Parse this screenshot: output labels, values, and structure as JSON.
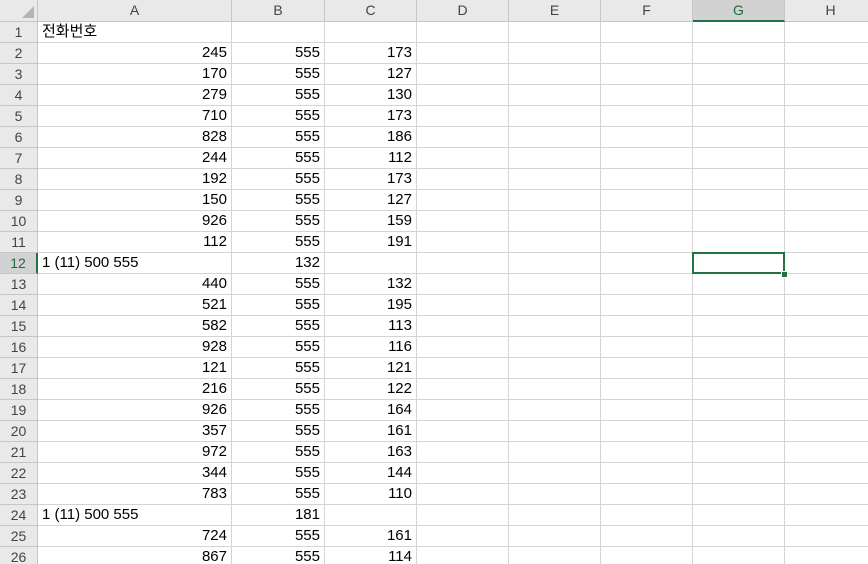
{
  "columns": [
    "A",
    "B",
    "C",
    "D",
    "E",
    "F",
    "G",
    "H"
  ],
  "active_column": "G",
  "active_row": 12,
  "rows": [
    {
      "n": "1",
      "a": "전화번호",
      "a_kind": "text",
      "b": "",
      "c": ""
    },
    {
      "n": "2",
      "a": "245",
      "a_kind": "num",
      "b": "555",
      "c": "173"
    },
    {
      "n": "3",
      "a": "170",
      "a_kind": "num",
      "b": "555",
      "c": "127"
    },
    {
      "n": "4",
      "a": "279",
      "a_kind": "num",
      "b": "555",
      "c": "130"
    },
    {
      "n": "5",
      "a": "710",
      "a_kind": "num",
      "b": "555",
      "c": "173"
    },
    {
      "n": "6",
      "a": "828",
      "a_kind": "num",
      "b": "555",
      "c": "186"
    },
    {
      "n": "7",
      "a": "244",
      "a_kind": "num",
      "b": "555",
      "c": "112"
    },
    {
      "n": "8",
      "a": "192",
      "a_kind": "num",
      "b": "555",
      "c": "173"
    },
    {
      "n": "9",
      "a": "150",
      "a_kind": "num",
      "b": "555",
      "c": "127"
    },
    {
      "n": "10",
      "a": "926",
      "a_kind": "num",
      "b": "555",
      "c": "159"
    },
    {
      "n": "11",
      "a": "112",
      "a_kind": "num",
      "b": "555",
      "c": "191"
    },
    {
      "n": "12",
      "a": "1 (11) 500 555",
      "a_kind": "text",
      "b": "132",
      "c": ""
    },
    {
      "n": "13",
      "a": "440",
      "a_kind": "num",
      "b": "555",
      "c": "132"
    },
    {
      "n": "14",
      "a": "521",
      "a_kind": "num",
      "b": "555",
      "c": "195"
    },
    {
      "n": "15",
      "a": "582",
      "a_kind": "num",
      "b": "555",
      "c": "113"
    },
    {
      "n": "16",
      "a": "928",
      "a_kind": "num",
      "b": "555",
      "c": "116"
    },
    {
      "n": "17",
      "a": "121",
      "a_kind": "num",
      "b": "555",
      "c": "121"
    },
    {
      "n": "18",
      "a": "216",
      "a_kind": "num",
      "b": "555",
      "c": "122"
    },
    {
      "n": "19",
      "a": "926",
      "a_kind": "num",
      "b": "555",
      "c": "164"
    },
    {
      "n": "20",
      "a": "357",
      "a_kind": "num",
      "b": "555",
      "c": "161"
    },
    {
      "n": "21",
      "a": "972",
      "a_kind": "num",
      "b": "555",
      "c": "163"
    },
    {
      "n": "22",
      "a": "344",
      "a_kind": "num",
      "b": "555",
      "c": "144"
    },
    {
      "n": "23",
      "a": "783",
      "a_kind": "num",
      "b": "555",
      "c": "110"
    },
    {
      "n": "24",
      "a": "1 (11) 500 555",
      "a_kind": "text",
      "b": "181",
      "c": ""
    },
    {
      "n": "25",
      "a": "724",
      "a_kind": "num",
      "b": "555",
      "c": "161"
    },
    {
      "n": "26",
      "a": "867",
      "a_kind": "num",
      "b": "555",
      "c": "114"
    }
  ]
}
